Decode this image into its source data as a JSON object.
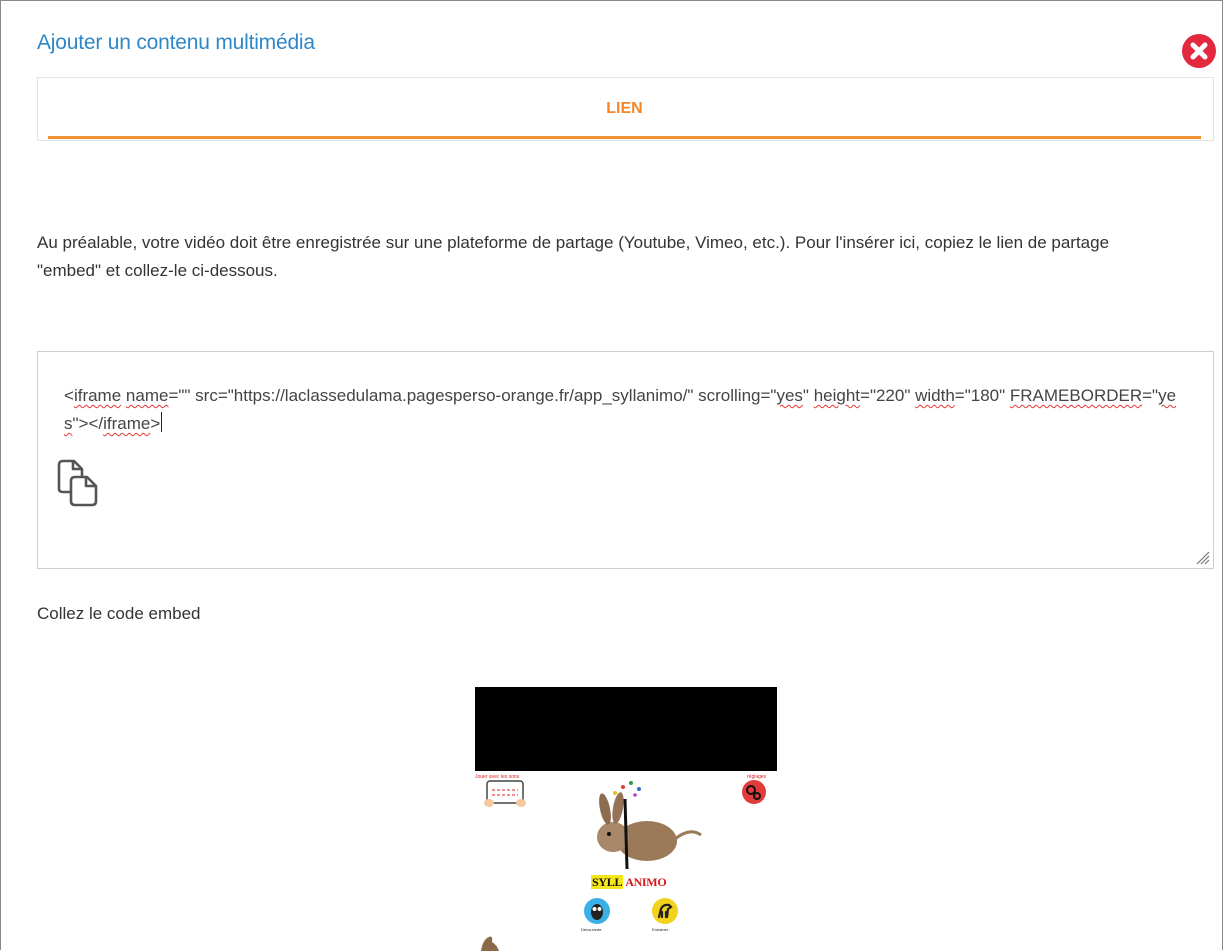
{
  "dialog": {
    "title": "Ajouter un contenu multimédia",
    "close_icon": "close-circle-icon",
    "tab_label": "LIEN",
    "instructions": "Au préalable, votre vidéo doit être enregistrée sur une plateforme de partage (Youtube, Vimeo, etc.). Pour l'insérer ici, copiez le lien de partage \"embed\" et collez-le ci-dessous.",
    "embed_value": {
      "part1": "<",
      "w_iframe": "iframe",
      "part2": " ",
      "w_name": "name",
      "part3": "=\"\" src=\"https://laclassedulama.pagesperso-orange.fr/app_syllanimo/\" scrolling=\"",
      "w_yes1": "yes",
      "part4": "\" ",
      "w_height": "height",
      "part5": "=\"220\" ",
      "w_width": "width",
      "part6": "=\"180\" ",
      "w_frameborder": "FRAMEBORDER",
      "part7": "=\"",
      "w_yes2": "yes",
      "part8": "\"></",
      "w_iframe2": "iframe",
      "part9": ">"
    },
    "paste_label": "Collez le code embed",
    "preview": {
      "brand_part1": "SYLL",
      "brand_part2": "ANIMO",
      "left_caption": "Jouer avec les sons",
      "right_caption": "réglages",
      "app1_label": "Découverte",
      "app2_label": "Entrainer"
    },
    "colors": {
      "title": "#2f87c7",
      "tab": "#f5862a",
      "close": "#e2293f"
    }
  }
}
